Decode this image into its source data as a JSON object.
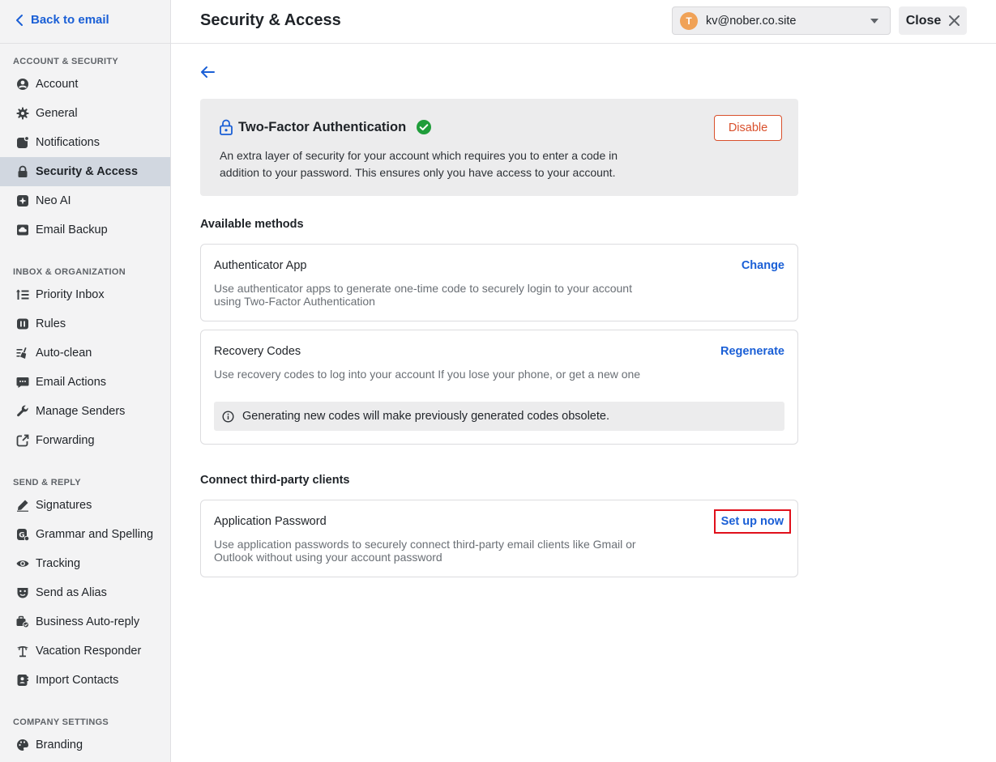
{
  "sidebar": {
    "back_label": "Back to email",
    "sections": [
      {
        "title": "ACCOUNT & SECURITY",
        "items": [
          {
            "label": "Account",
            "icon": "user-circle-icon"
          },
          {
            "label": "General",
            "icon": "gear-icon"
          },
          {
            "label": "Notifications",
            "icon": "notification-icon"
          },
          {
            "label": "Security & Access",
            "icon": "lock-icon",
            "active": true
          },
          {
            "label": "Neo AI",
            "icon": "sparkle-icon"
          },
          {
            "label": "Email Backup",
            "icon": "cloud-backup-icon"
          }
        ]
      },
      {
        "title": "INBOX & ORGANIZATION",
        "items": [
          {
            "label": "Priority Inbox",
            "icon": "priority-list-icon"
          },
          {
            "label": "Rules",
            "icon": "rules-icon"
          },
          {
            "label": "Auto-clean",
            "icon": "broom-icon"
          },
          {
            "label": "Email Actions",
            "icon": "email-actions-icon"
          },
          {
            "label": "Manage Senders",
            "icon": "wrench-icon"
          },
          {
            "label": "Forwarding",
            "icon": "forward-icon"
          }
        ]
      },
      {
        "title": "SEND & REPLY",
        "items": [
          {
            "label": "Signatures",
            "icon": "pen-icon"
          },
          {
            "label": "Grammar and Spelling",
            "icon": "grammar-icon"
          },
          {
            "label": "Tracking",
            "icon": "eye-icon"
          },
          {
            "label": "Send as Alias",
            "icon": "mask-icon"
          },
          {
            "label": "Business Auto-reply",
            "icon": "auto-reply-icon"
          },
          {
            "label": "Vacation Responder",
            "icon": "palm-tree-icon"
          },
          {
            "label": "Import Contacts",
            "icon": "contacts-icon"
          }
        ]
      },
      {
        "title": "COMPANY SETTINGS",
        "items": [
          {
            "label": "Branding",
            "icon": "palette-icon"
          }
        ]
      }
    ]
  },
  "header": {
    "title": "Security & Access",
    "account": {
      "avatar_letter": "T",
      "email": "kv@nober.co.site"
    },
    "close_label": "Close"
  },
  "tfa": {
    "title": "Two-Factor Authentication",
    "description": "An extra layer of security for your account which requires you to enter a code in addition to your password. This ensures only you have access to your account.",
    "disable_label": "Disable"
  },
  "methods": {
    "heading": "Available methods",
    "authenticator": {
      "title": "Authenticator App",
      "description": "Use authenticator apps to generate one-time code to securely login to your account using Two-Factor Authentication",
      "action": "Change"
    },
    "recovery": {
      "title": "Recovery Codes",
      "description": "Use recovery codes to log into your account If you lose your phone, or get a new one",
      "action": "Regenerate",
      "notice": "Generating new codes will make previously generated codes obsolete."
    }
  },
  "third_party": {
    "heading": "Connect third-party clients",
    "app_password": {
      "title": "Application Password",
      "description": "Use application passwords to securely connect third-party email clients like Gmail or Outlook without using your account password",
      "action": "Set up now"
    }
  },
  "colors": {
    "accent": "#1a5fd6",
    "danger": "#d9502c",
    "success": "#1f9d3a",
    "avatar": "#f0a257",
    "highlight": "#e0101b"
  }
}
